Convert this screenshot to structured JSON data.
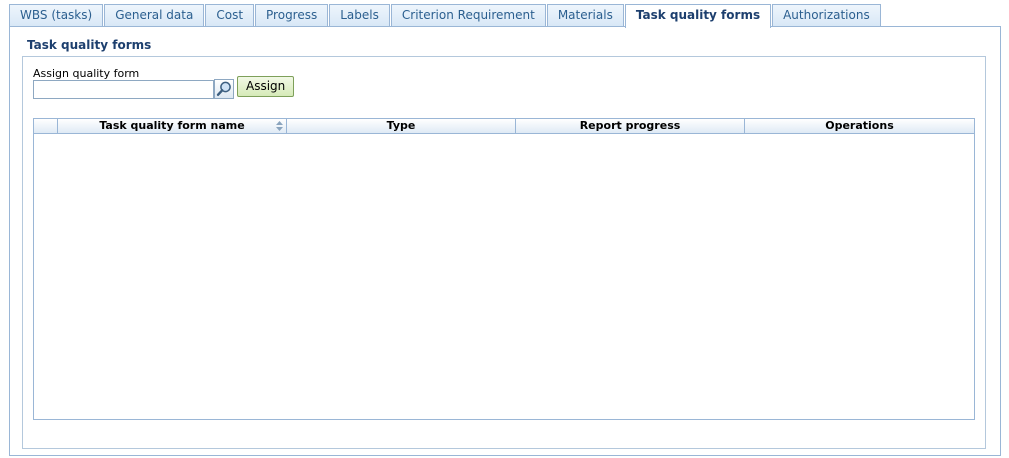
{
  "tabs": [
    {
      "label": "WBS (tasks)",
      "active": false
    },
    {
      "label": "General data",
      "active": false
    },
    {
      "label": "Cost",
      "active": false
    },
    {
      "label": "Progress",
      "active": false
    },
    {
      "label": "Labels",
      "active": false
    },
    {
      "label": "Criterion Requirement",
      "active": false
    },
    {
      "label": "Materials",
      "active": false
    },
    {
      "label": "Task quality forms",
      "active": true
    },
    {
      "label": "Authorizations",
      "active": false
    }
  ],
  "panel": {
    "title": "Task quality forms",
    "assign_label": "Assign quality form",
    "assign_input_value": "",
    "search_icon": "search-icon",
    "assign_button_label": "Assign"
  },
  "grid": {
    "columns": [
      "",
      "Task quality form name",
      "Type",
      "Report progress",
      "Operations"
    ],
    "sort_icon": "sort-icon",
    "rows": []
  },
  "colors": {
    "accent": "#1d3f6e",
    "tab_text": "#2b5f8f",
    "border": "#9ab6d6",
    "assign_button_bg": "#d6eab8"
  }
}
